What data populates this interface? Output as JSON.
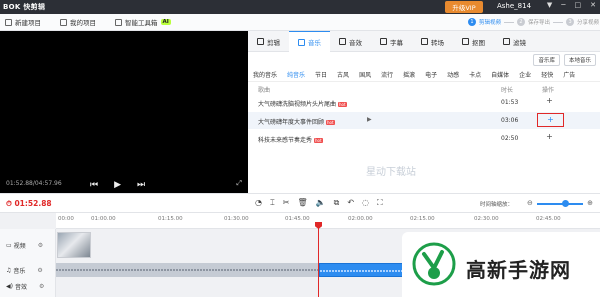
{
  "titlebar": {
    "app_name": "BOK 快剪辑",
    "vip": "升级VIP",
    "user": "Ashe_814",
    "win_buttons": [
      "▼",
      "─",
      "□",
      "✕"
    ]
  },
  "toolbar": {
    "items": [
      "新建项目",
      "我的项目",
      "智能工具箱"
    ],
    "ai_badge": "AI"
  },
  "steps": [
    {
      "num": "1",
      "label": "剪辑视频"
    },
    {
      "num": "2",
      "label": "保存导出"
    },
    {
      "num": "3",
      "label": "分享视频"
    }
  ],
  "preview": {
    "time": "01:52.88/04:57.96"
  },
  "categories": [
    "剪辑",
    "音乐",
    "音效",
    "字幕",
    "转场",
    "抠图",
    "滤镜"
  ],
  "library_buttons": [
    "音乐库",
    "本地音乐"
  ],
  "genres": [
    "我的音乐",
    "纯音乐",
    "节日",
    "古风",
    "国风",
    "流行",
    "摇滚",
    "电子",
    "动感",
    "卡点",
    "自媒体",
    "企业",
    "轻快",
    "广告"
  ],
  "table": {
    "headers": {
      "name": "歌曲",
      "duration": "时长",
      "action": "操作"
    },
    "rows": [
      {
        "name": "大气磅礴洗脑视频片头片尾曲",
        "duration": "01:53"
      },
      {
        "name": "大气磅礴年度大事件回顾",
        "duration": "03:06"
      },
      {
        "name": "科技未来感节奏走秀",
        "duration": "02:50"
      }
    ]
  },
  "watermark": "星动下载站",
  "timeline": {
    "current_time": "01:52.88",
    "zoom_label": "时间轴缩放：",
    "zoom_level": 0.6,
    "ticks": [
      "00:00",
      "01:00.00",
      "01:15.00",
      "01:30.00",
      "01:45.00",
      "02:00.00",
      "02:15.00",
      "02:30.00",
      "02:45.00"
    ],
    "tracks": [
      "视频",
      "音乐",
      "音效"
    ]
  },
  "brand": {
    "text": "高新手游网"
  }
}
